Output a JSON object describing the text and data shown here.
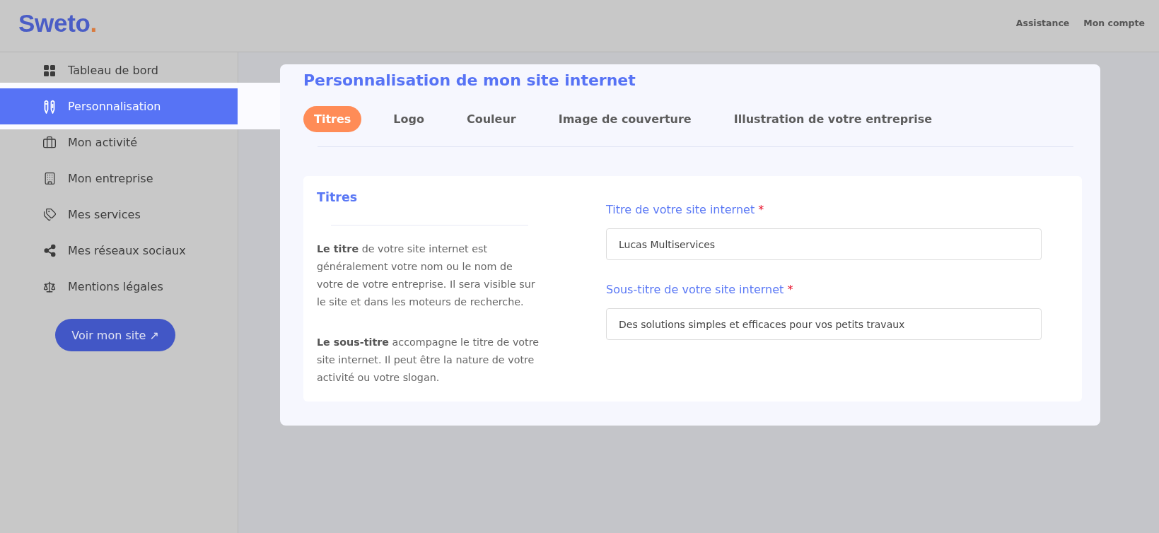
{
  "header": {
    "logo": {
      "text": "Sweto",
      "dot": "."
    },
    "links": [
      {
        "label": "Assistance"
      },
      {
        "label": "Mon compte"
      }
    ]
  },
  "sidebar": {
    "items": [
      {
        "label": "Tableau de bord",
        "selected": false
      },
      {
        "label": "Personnalisation",
        "selected": true
      },
      {
        "label": "Mon activité",
        "selected": false
      },
      {
        "label": "Mon entreprise",
        "selected": false
      },
      {
        "label": "Mes services",
        "selected": false
      },
      {
        "label": "Mes réseaux sociaux",
        "selected": false
      },
      {
        "label": "Mentions légales",
        "selected": false
      }
    ],
    "view_site_button": "Voir mon site ↗"
  },
  "content": {
    "title": "Personnalisation de mon site internet",
    "tabs": [
      {
        "label": "Titres",
        "selected": true
      },
      {
        "label": "Logo",
        "selected": false
      },
      {
        "label": "Couleur",
        "selected": false
      },
      {
        "label": "Image de couverture",
        "selected": false
      },
      {
        "label": "Illustration de votre entreprise",
        "selected": false
      }
    ],
    "section": {
      "title": "Titres",
      "paragraphs": [
        "**Le titre** de votre site internet est généralement votre nom ou le nom de votre de votre entreprise. Il sera visible sur le site et dans les moteurs de recherche.",
        "**Le sous-titre** accompagne le titre de votre site internet. Il peut être la nature de votre activité ou votre slogan."
      ],
      "fields": [
        {
          "label": "Titre de votre site internet",
          "required_mark": "*",
          "value": "Lucas Multiservices"
        },
        {
          "label": "Sous-titre de votre site internet",
          "required_mark": "*",
          "value": "Des solutions simples et efficaces pour vos petits travaux"
        }
      ]
    }
  }
}
